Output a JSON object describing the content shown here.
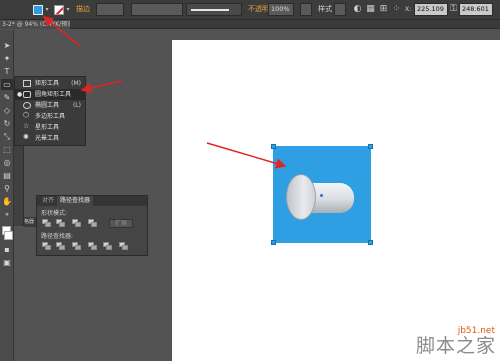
{
  "control_bar": {
    "fill_color": "#2b9ee5",
    "stroke_color": "#ffffff",
    "stroke_label": "描边",
    "opacity_label": "不透明度",
    "opacity_value": "100%",
    "style_label": "样式",
    "width_value": "225.109",
    "height_value": "248.601"
  },
  "document_tab": {
    "title": "3-2* @ 94% (CMYK/预览)"
  },
  "tool_flyout": {
    "items": [
      {
        "label": "矩形工具",
        "shortcut": "(M)",
        "icon": "rect-icon",
        "selected": false
      },
      {
        "label": "圆角矩形工具",
        "shortcut": "",
        "icon": "rounded-rect-icon",
        "selected": true
      },
      {
        "label": "椭圆工具",
        "shortcut": "(L)",
        "icon": "ellipse-icon",
        "selected": false
      },
      {
        "label": "多边形工具",
        "shortcut": "",
        "icon": "polygon-icon",
        "selected": false
      },
      {
        "label": "星形工具",
        "shortcut": "",
        "icon": "star-icon",
        "selected": false
      },
      {
        "label": "光晕工具",
        "shortcut": "",
        "icon": "flare-icon",
        "selected": false
      }
    ]
  },
  "pathfinder_panel": {
    "tab_align": "对齐",
    "tab_pathfinder": "路径查找器",
    "shape_modes_label": "形状模式:",
    "pathfinders_label": "路径查找器:",
    "expand_label": "扩展",
    "side_label": "格器"
  },
  "canvas": {
    "shape_color": "#2e9fe3",
    "arrow_color": "#e02424"
  },
  "watermark": {
    "site": "jb51.net",
    "name": "脚本之家"
  }
}
